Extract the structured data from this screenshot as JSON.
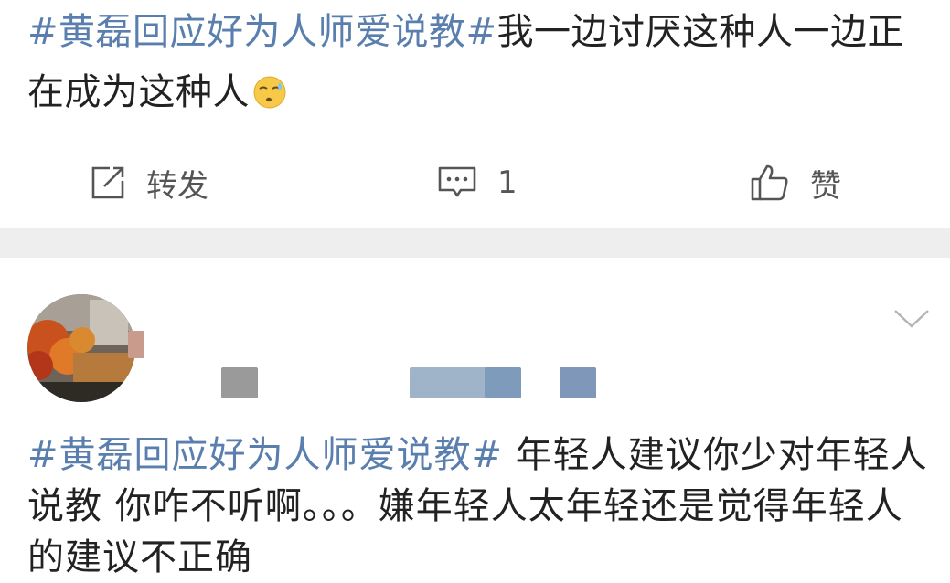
{
  "post1": {
    "hashtag": "#黄磊回应好为人师爱说教#",
    "body": "我一边讨厌这种人一边正在成为这种人",
    "emoji_icon": "sweat-face-icon"
  },
  "actions": {
    "share_label": "转发",
    "comment_count": "1",
    "like_label": "赞"
  },
  "post2": {
    "hashtag": "#黄磊回应好为人师爱说教#",
    "body": " 年轻人建议你少对年轻人说教 你咋不听啊。。。嫌年轻人太年轻还是觉得年轻人的建议不正确"
  },
  "colors": {
    "hashtag": "#5a7fae",
    "divider": "#eeeeee",
    "icon": "#555555"
  }
}
